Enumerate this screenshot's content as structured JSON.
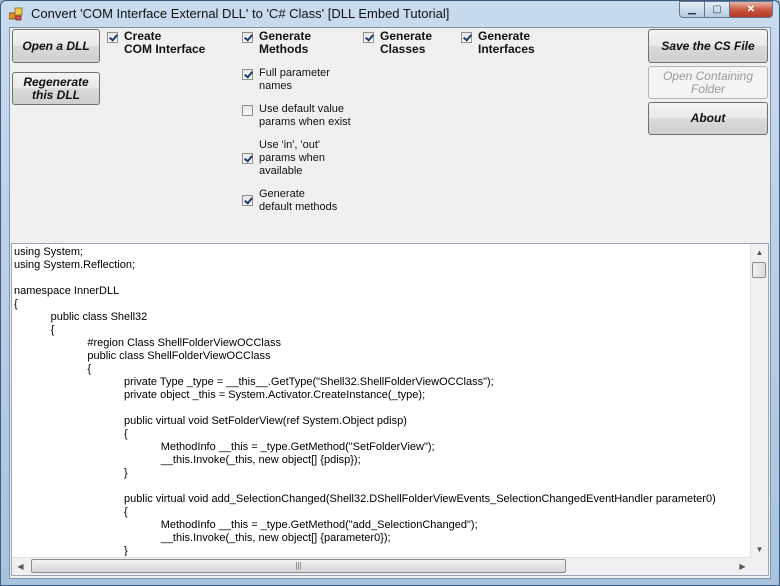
{
  "window": {
    "title": "Convert 'COM Interface External DLL' to 'C# Class' [DLL Embed Tutorial]",
    "controls": {
      "minimize": "▁",
      "maximize": "▢",
      "close": "✕"
    }
  },
  "buttons": {
    "open_dll": "Open a DLL",
    "regenerate": "Regenerate\nthis DLL",
    "save_cs": "Save the CS File",
    "open_folder": "Open Containing\nFolder",
    "about": "About"
  },
  "options": {
    "create_com": {
      "label": "Create\nCOM Interface",
      "checked": true
    },
    "gen_methods": {
      "label": "Generate\nMethods",
      "checked": true
    },
    "gen_classes": {
      "label": "Generate\nClasses",
      "checked": true
    },
    "gen_interfaces": {
      "label": "Generate\nInterfaces",
      "checked": true
    },
    "full_param_names": {
      "label": "Full parameter\nnames",
      "checked": true
    },
    "default_values": {
      "label": "Use default value\nparams when exist",
      "checked": false
    },
    "in_out": {
      "label": "Use 'in', 'out'\nparams when\navailable",
      "checked": true
    },
    "default_methods": {
      "label": "Generate\ndefault methods",
      "checked": true
    }
  },
  "code": {
    "lines": [
      "using System;",
      "using System.Reflection;",
      "",
      "namespace InnerDLL",
      "{",
      "\tpublic class Shell32",
      "\t{",
      "\t\t#region Class ShellFolderViewOCClass",
      "\t\tpublic class ShellFolderViewOCClass",
      "\t\t{",
      "\t\t\tprivate Type _type = __this__.GetType(\"Shell32.ShellFolderViewOCClass\");",
      "\t\t\tprivate object _this = System.Activator.CreateInstance(_type);",
      "",
      "\t\t\tpublic virtual void SetFolderView(ref System.Object pdisp)",
      "\t\t\t{",
      "\t\t\t\tMethodInfo __this = _type.GetMethod(\"SetFolderView\");",
      "\t\t\t\t__this.Invoke(_this, new object[] {pdisp});",
      "\t\t\t}",
      "",
      "\t\t\tpublic virtual void add_SelectionChanged(Shell32.DShellFolderViewEvents_SelectionChangedEventHandler parameter0)",
      "\t\t\t{",
      "\t\t\t\tMethodInfo __this = _type.GetMethod(\"add_SelectionChanged\");",
      "\t\t\t\t__this.Invoke(_this, new object[] {parameter0});",
      "\t\t\t}"
    ]
  },
  "scrollbars": {
    "up": "▲",
    "down": "▼",
    "left": "◀",
    "right": "▶",
    "grip": "|||"
  }
}
